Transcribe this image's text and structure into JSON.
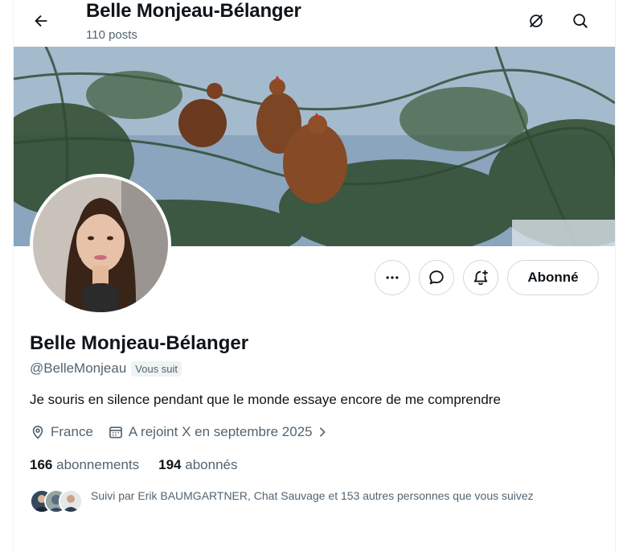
{
  "header": {
    "name": "Belle Monjeau-Bélanger",
    "posts": "110 posts"
  },
  "profile": {
    "display_name": "Belle Monjeau-Bélanger",
    "handle": "@BelleMonjeau",
    "follows_you": "Vous suit",
    "bio": "Je souris en silence pendant que le monde essaye encore de me comprendre",
    "location": "France",
    "joined": "A rejoint X en septembre 2025"
  },
  "actions": {
    "follow_label": "Abonné"
  },
  "stats": {
    "following_count": "166",
    "following_label": "abonnements",
    "followers_count": "194",
    "followers_label": "abonnés"
  },
  "followed_by": {
    "text": "Suivi par Erik BAUMGARTNER, Chat Sauvage et 153 autres personnes que vous suivez"
  },
  "icons": {
    "back": "arrow-left-icon",
    "grok": "grok-icon",
    "search": "search-icon",
    "more": "more-icon",
    "message": "message-icon",
    "notify": "bell-plus-icon",
    "location": "location-pin-icon",
    "calendar": "calendar-icon"
  },
  "colors": {
    "text": "#0f1419",
    "secondary": "#536471",
    "border": "#cfd9de"
  }
}
